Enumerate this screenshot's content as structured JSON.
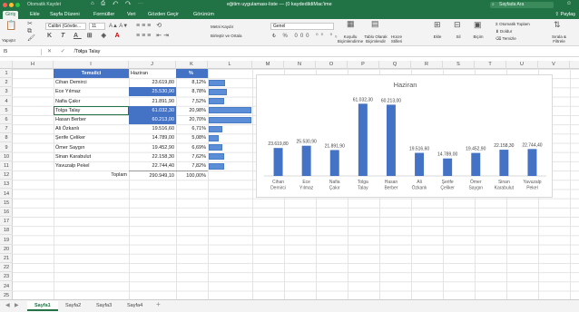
{
  "titlebar": {
    "autosave": "Otomatik Kaydet",
    "filename": "eğitim uygulaması-liste — (0 kaydedildiMac'ime",
    "search": "Sayfada Ara"
  },
  "tabs": [
    "Giriş",
    "Ekle",
    "Sayfa Düzeni",
    "Formüller",
    "Veri",
    "Gözden Geçir",
    "Görünüm"
  ],
  "share": "Paylaş",
  "ribbon": {
    "paste": "Yapıştır",
    "font": "Calibri (Gövde...",
    "size": "11",
    "wrap": "Metni Kaydır",
    "merge": "Birleştir ve Ortala",
    "numformat": "Genel",
    "cond": "Koşullu Biçimlendirme",
    "table": "Tablo Olarak Biçimlendir",
    "cellstyles": "Hücre Stilleri",
    "insert": "Ekle",
    "delete": "Sil",
    "format": "Biçim",
    "autosum": "Otomatik Toplam",
    "fill": "Doldur",
    "clear": "Temizle",
    "sort": "Sırala & Filtrele"
  },
  "formula": {
    "namebox": "I5",
    "value": "Tolga Talay"
  },
  "columns": [
    "H",
    "I",
    "J",
    "K",
    "L",
    "M",
    "N",
    "O",
    "P",
    "Q",
    "R",
    "S",
    "T",
    "U",
    "V"
  ],
  "rows": [
    "1",
    "2",
    "3",
    "4",
    "5",
    "6",
    "7",
    "8",
    "9",
    "10",
    "11",
    "12",
    "13",
    "14",
    "15",
    "16",
    "17",
    "18",
    "19",
    "20",
    "21",
    "22",
    "23",
    "24",
    "25"
  ],
  "table": {
    "headers": [
      "Temsilci",
      "Haziran",
      "%"
    ],
    "rows": [
      {
        "name": "Cihan Demirci",
        "value": "23.619,80",
        "pct": "8,12%",
        "frac": 0.39
      },
      {
        "name": "Ece Yılmaz",
        "value": "25.530,90",
        "pct": "8,78%",
        "frac": 0.42
      },
      {
        "name": "Nafia Çakır",
        "value": "21.891,90",
        "pct": "7,52%",
        "frac": 0.36
      },
      {
        "name": "Tolga Talay",
        "value": "61.032,30",
        "pct": "20,98%",
        "frac": 1.0
      },
      {
        "name": "Hasan Berber",
        "value": "60.213,00",
        "pct": "20,70%",
        "frac": 0.99
      },
      {
        "name": "Ali Özkanlı",
        "value": "19.516,60",
        "pct": "6,71%",
        "frac": 0.32
      },
      {
        "name": "Şerife Çeliker",
        "value": "14.789,00",
        "pct": "5,08%",
        "frac": 0.24
      },
      {
        "name": "Ömer Saygın",
        "value": "19.452,90",
        "pct": "6,69%",
        "frac": 0.32
      },
      {
        "name": "Sinan Karabulut",
        "value": "22.158,30",
        "pct": "7,62%",
        "frac": 0.36
      },
      {
        "name": "Yavuzalp Pekel",
        "value": "22.744,40",
        "pct": "7,82%",
        "frac": 0.37
      }
    ],
    "total_label": "Toplam",
    "total_value": "290.949,10",
    "total_pct": "100,00%"
  },
  "chart_data": {
    "type": "bar",
    "title": "Haziran",
    "categories": [
      "Cihan Demirci",
      "Ece Yılmaz",
      "Nafia Çakır",
      "Tolga Talay",
      "Hasan Berber",
      "Ali Özkanlı",
      "Şerife Çeliker",
      "Ömer Saygın",
      "Sinan Karabulut",
      "Yavuzalp Pekel"
    ],
    "values": [
      23619.8,
      25530.9,
      21891.9,
      61032.3,
      60213.0,
      19516.6,
      14789.0,
      19452.9,
      22158.3,
      22744.4
    ],
    "labels": [
      "23.619,80",
      "25.530,90",
      "21.891,90",
      "61.032,30",
      "60.213,00",
      "19.516,60",
      "14.789,00",
      "19.452,90",
      "22.158,30",
      "22.744,40"
    ],
    "ylim": [
      0,
      65000
    ],
    "bar_color": "#4472c4",
    "grid": false
  },
  "sheets": [
    "Sayfa1",
    "Sayfa2",
    "Sayfa3",
    "Sayfa4"
  ],
  "colors": {
    "excel_green": "#217346",
    "header_blue": "#4472c4"
  }
}
